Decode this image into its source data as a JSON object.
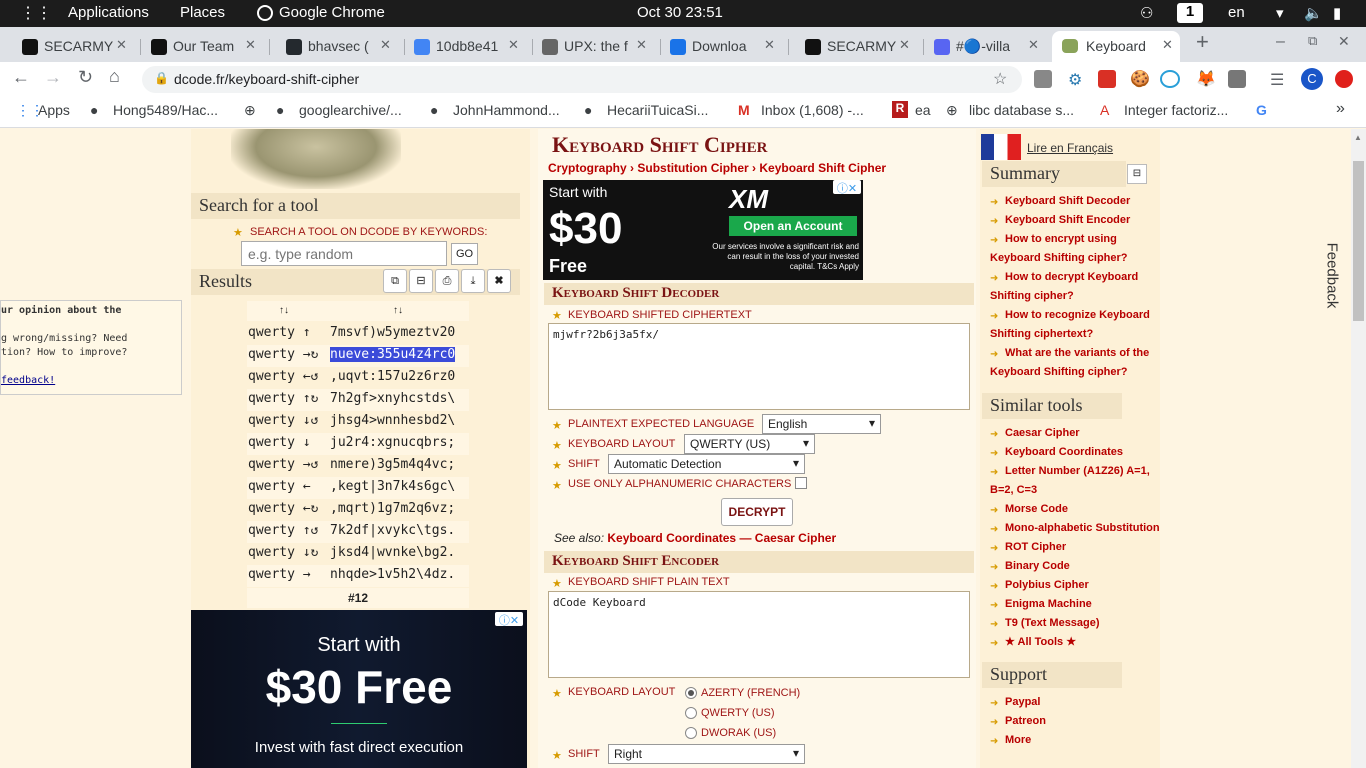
{
  "topbar": {
    "applications": "Applications",
    "places": "Places",
    "browser": "Google Chrome",
    "clock": "Oct 30  23:51",
    "workspace": "1",
    "lang": "en"
  },
  "tabs": [
    {
      "title": "SECARMY",
      "color": "#111"
    },
    {
      "title": "Our Team",
      "color": "#111"
    },
    {
      "title": "bhavsec (",
      "color": "#24292e"
    },
    {
      "title": "10db8e41",
      "color": "#4285f4"
    },
    {
      "title": "UPX: the f",
      "color": "#666"
    },
    {
      "title": "Downloa",
      "color": "#1a73e8"
    },
    {
      "title": "SECARMY",
      "color": "#111"
    },
    {
      "title": "#🔵-villa",
      "color": "#5865f2"
    },
    {
      "title": "Keyboard",
      "color": "#6b8e23"
    }
  ],
  "tab_close": "✕",
  "new_tab": "+",
  "address": {
    "url": "dcode.fr/keyboard-shift-cipher"
  },
  "bookmarks": [
    "Apps",
    "Hong5489/Hac...",
    "",
    "googlearchive/...",
    "JohnHammond...",
    "HecariiTuicaSi...",
    "Inbox (1,608) -...",
    "ea",
    "libc database s...",
    "Integer factoriz..."
  ],
  "left": {
    "search_title": "Search for a tool",
    "search_label": "SEARCH A TOOL ON DCODE BY KEYWORDS:",
    "search_placeholder": "e.g. type random",
    "go": "GO",
    "results_title": "Results",
    "col1": "↑↓",
    "col2": "↑↓",
    "rows": [
      [
        "qwerty ↑ ",
        "7msvf)w5ymeztv20"
      ],
      [
        "qwerty →↻",
        "nueve:355u4z4rc0"
      ],
      [
        "qwerty ←↺",
        ",uqvt:157u2z6rz0"
      ],
      [
        "qwerty ↑↻",
        "7h2gf>xnyhcstds\\"
      ],
      [
        "qwerty ↓↺",
        "jhsg4>wnnhesbd2\\"
      ],
      [
        "qwerty ↓ ",
        "ju2r4:xgnucqbrs;"
      ],
      [
        "qwerty →↺",
        "nmere)3g5m4q4vc;"
      ],
      [
        "qwerty ← ",
        ",kegt|3n7k4s6gc\\"
      ],
      [
        "qwerty ←↻",
        ",mqrt)1g7m2q6vz;"
      ],
      [
        "qwerty ↑↺",
        "7k2df|xvykc\\tgs."
      ],
      [
        "qwerty ↓↻",
        "jksd4|wvnke\\bg2."
      ],
      [
        "qwerty → ",
        "nhqde>1v5h2\\4dz."
      ]
    ],
    "counter": "#12",
    "feedback_lines": [
      "ur opinion about the",
      "",
      "g wrong/missing? Need",
      "tion? How to improve?",
      "",
      "feedback!"
    ],
    "ad_line1": "Start with",
    "ad_line2": "$30 Free",
    "ad_line3": "Invest with fast direct execution"
  },
  "mid": {
    "title": "Keyboard Shift Cipher",
    "crumbs": [
      "Cryptography",
      "›",
      "Substitution Cipher",
      "›",
      "Keyboard Shift Cipher"
    ],
    "ad_start": "Start with",
    "ad_amount": "$30",
    "ad_free": "Free",
    "ad_brand": "XM",
    "ad_btn": "Open an Account",
    "ad_fine": "Our services involve a significant risk and can result in the loss of your invested capital. T&Cs Apply",
    "decoder_title": "Keyboard Shift Decoder",
    "cipher_label": "KEYBOARD SHIFTED CIPHERTEXT",
    "cipher_value": "mjwfr?2b6j3a5fx/",
    "lang_label": "PLAINTEXT EXPECTED LANGUAGE",
    "lang_value": "English",
    "layout_label": "KEYBOARD LAYOUT",
    "layout_value": "QWERTY (US)",
    "shift_label": "SHIFT",
    "shift_value": "Automatic Detection",
    "alnum_label": "USE ONLY ALPHANUMERIC CHARACTERS",
    "decrypt": "DECRYPT",
    "seealso": "See also:",
    "seealso_a": "Keyboard Coordinates",
    "seealso_dash": "—",
    "seealso_b": "Caesar Cipher",
    "encoder_title": "Keyboard Shift Encoder",
    "plain_label": "KEYBOARD SHIFT PLAIN TEXT",
    "plain_value": "dCode Keyboard",
    "enc_layout_label": "KEYBOARD LAYOUT",
    "radio1": "AZERTY (FRENCH)",
    "radio2": "QWERTY (US)",
    "radio3": "DWORAK (US)",
    "enc_shift_label": "SHIFT",
    "enc_shift_value": "Right"
  },
  "right": {
    "french": "Lire en Français",
    "summary_title": "Summary",
    "summary": [
      "Keyboard Shift Decoder",
      "Keyboard Shift Encoder",
      "How to encrypt using",
      "Keyboard Shifting cipher?",
      "How to decrypt Keyboard",
      "Shifting cipher?",
      "How to recognize Keyboard",
      "Shifting ciphertext?",
      "What are the variants of the",
      "Keyboard Shifting cipher?"
    ],
    "similar_title": "Similar tools",
    "similar": [
      "Caesar Cipher",
      "Keyboard Coordinates",
      "Letter Number (A1Z26) A=1,",
      "B=2, C=3",
      "Morse Code",
      "Mono-alphabetic Substitution",
      "ROT Cipher",
      "Binary Code",
      "Polybius Cipher",
      "Enigma Machine",
      "T9 (Text Message)",
      "★ All Tools ★"
    ],
    "support_title": "Support",
    "support": [
      "Paypal",
      "Patreon",
      "More"
    ],
    "feedback": "Feedback"
  }
}
